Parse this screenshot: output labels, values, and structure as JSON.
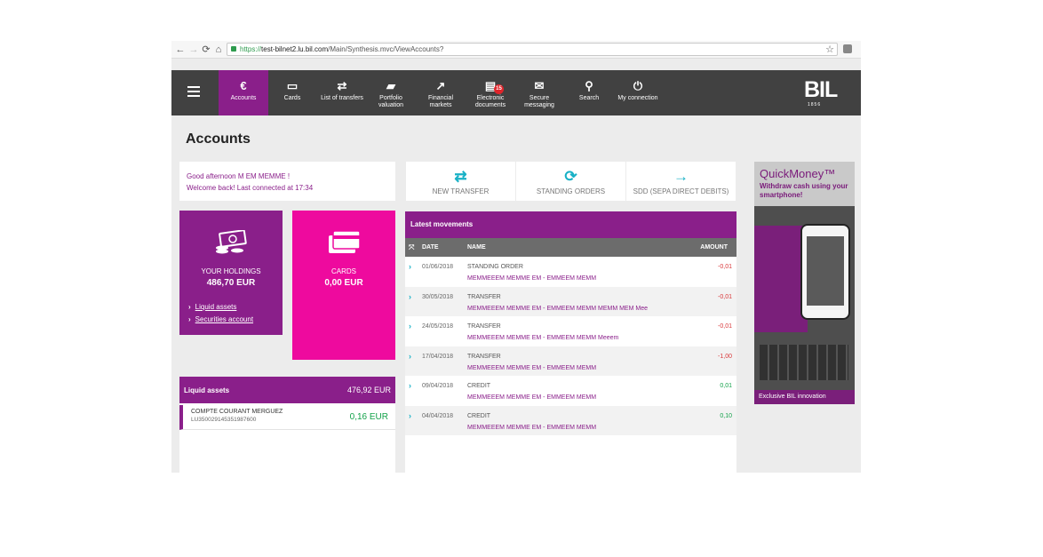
{
  "browser": {
    "back": "←",
    "forward": "→",
    "reload": "⟳",
    "home": "⌂",
    "url_scheme": "https://",
    "url_host": "test-bilnet2.lu.bil.com",
    "url_path": "/Main/Synthesis.mvc/ViewAccounts?",
    "star": "☆"
  },
  "nav": {
    "items": [
      {
        "label": "Accounts",
        "icon": "€",
        "active": true
      },
      {
        "label": "Cards",
        "icon": "▭"
      },
      {
        "label": "List of transfers",
        "icon": "⇄"
      },
      {
        "label": "Portfolio valuation",
        "icon": "▰"
      },
      {
        "label": "Financial markets",
        "icon": "↗"
      },
      {
        "label": "Electronic documents",
        "icon": "▤",
        "badge": "15"
      },
      {
        "label": "Secure messaging",
        "icon": "✉"
      },
      {
        "label": "Search",
        "icon": "⚲"
      },
      {
        "label": "My connection",
        "icon": "⏻"
      }
    ],
    "logo": "BIL",
    "logo_year": "1856"
  },
  "page": {
    "title": "Accounts"
  },
  "greeting": {
    "line1": "Good afternoon M EM MEMME !",
    "line2": "Welcome back! Last connected at 17:34"
  },
  "actions": [
    {
      "label": "NEW TRANSFER",
      "icon": "⇄"
    },
    {
      "label": "STANDING ORDERS",
      "icon": "⟳"
    },
    {
      "label": "SDD (SEPA DIRECT DEBITS)",
      "icon": "→"
    }
  ],
  "holdings": {
    "label": "YOUR HOLDINGS",
    "value": "486,70 EUR",
    "links": [
      "Liquid assets",
      "Securities account"
    ]
  },
  "cards": {
    "label": "CARDS",
    "value": "0,00 EUR"
  },
  "liquid": {
    "title": "Liquid assets",
    "total": "476,92 EUR",
    "account_name": "COMPTE COURANT MERGUEZ",
    "iban": "LU350029145351987600",
    "balance": "0,16 EUR"
  },
  "movements": {
    "title": "Latest movements",
    "columns": {
      "date": "DATE",
      "name": "NAME",
      "amount": "AMOUNT"
    },
    "rows": [
      {
        "date": "01/06/2018",
        "type": "STANDING ORDER",
        "desc": "MEMMEEEM MEMME EM - EMMEEM MEMM",
        "amount": "-0,01",
        "color": "#d9383a"
      },
      {
        "date": "30/05/2018",
        "type": "TRANSFER",
        "desc": "MEMMEEEM MEMME EM - EMMEEM MEMM MEMM MEM Mee",
        "amount": "-0,01",
        "color": "#d9383a"
      },
      {
        "date": "24/05/2018",
        "type": "TRANSFER",
        "desc": "MEMMEEEM MEMME EM - EMMEEM MEMM Meeem",
        "amount": "-0,01",
        "color": "#d9383a"
      },
      {
        "date": "17/04/2018",
        "type": "TRANSFER",
        "desc": "MEMMEEEM MEMME EM - EMMEEM MEMM",
        "amount": "-1,00",
        "color": "#d9383a"
      },
      {
        "date": "09/04/2018",
        "type": "CREDIT",
        "desc": "MEMMEEEM MEMME EM - EMMEEM MEMM",
        "amount": "0,01",
        "color": "#13a24a"
      },
      {
        "date": "04/04/2018",
        "type": "CREDIT",
        "desc": "MEMMEEEM MEMME EM - EMMEEM MEMM",
        "amount": "0,10",
        "color": "#13a24a"
      }
    ]
  },
  "ad": {
    "title": "QuickMoney™",
    "subtitle": "Withdraw cash using your smartphone!",
    "footer": "Exclusive BIL innovation"
  }
}
